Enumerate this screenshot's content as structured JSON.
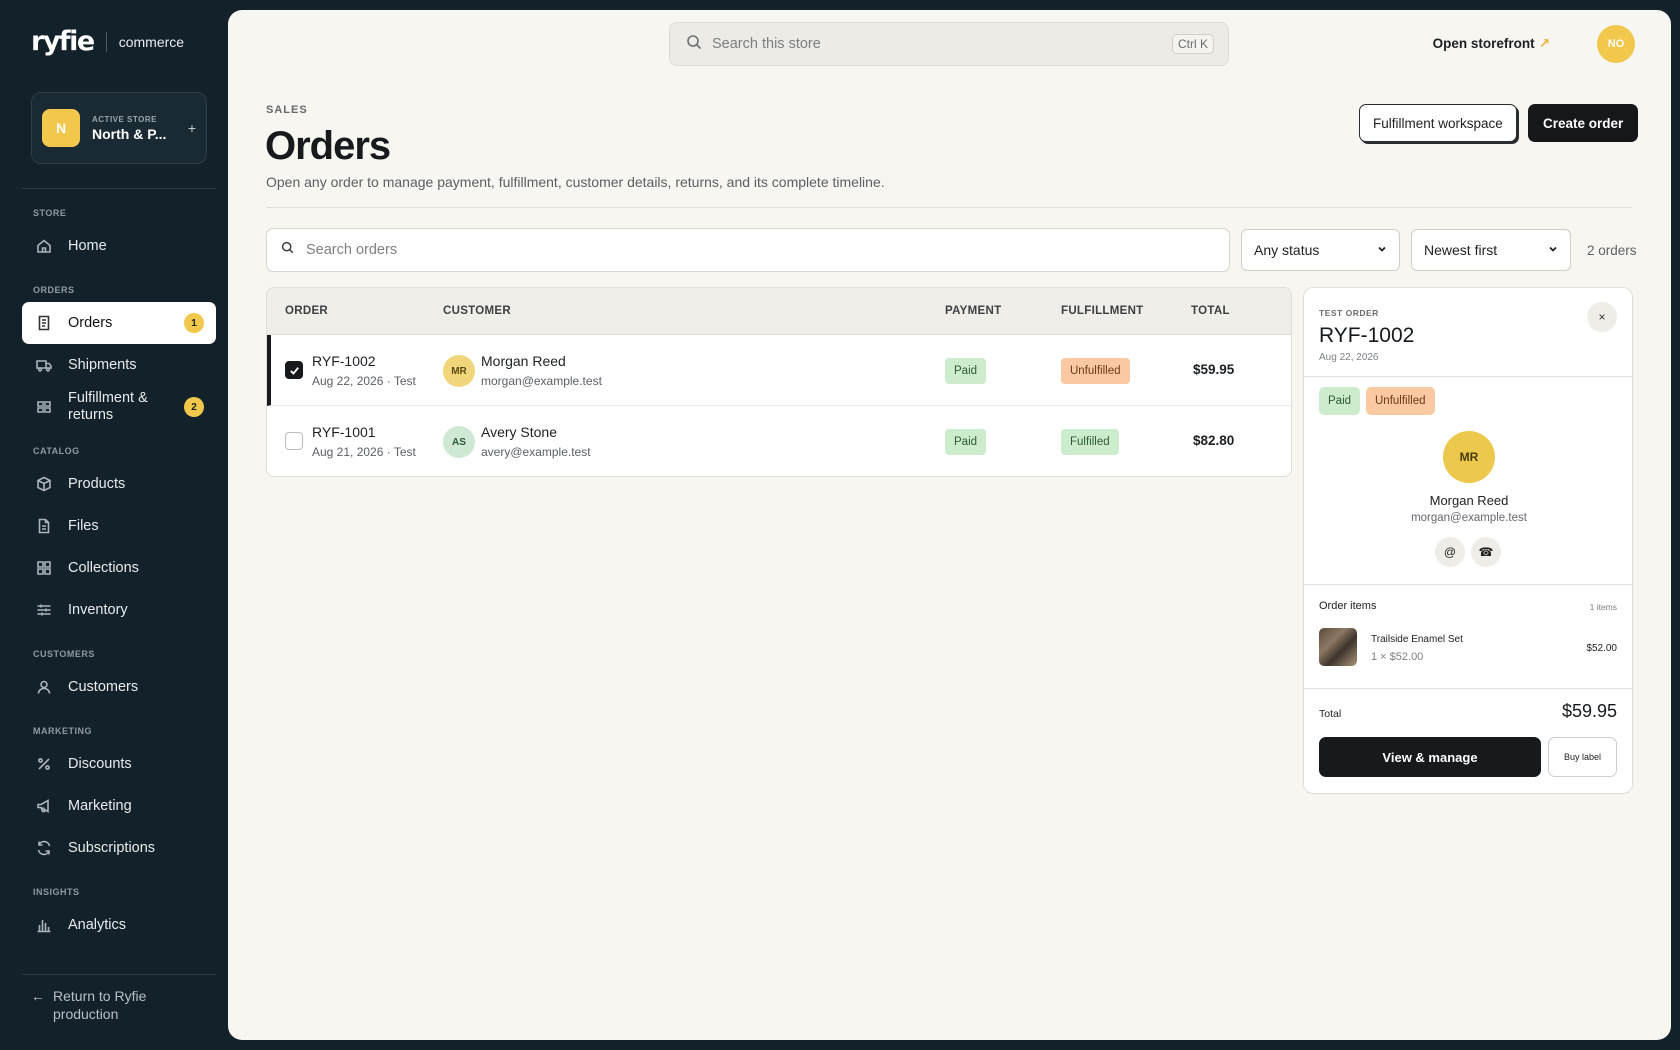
{
  "brand": {
    "logo": "ryfie",
    "sub": "commerce"
  },
  "store": {
    "initial": "N",
    "label": "ACTIVE STORE",
    "name": "North & P...",
    "add": "+"
  },
  "nav": {
    "store_group": "STORE",
    "home": "Home",
    "orders_group": "ORDERS",
    "orders": "Orders",
    "orders_badge": "1",
    "shipments": "Shipments",
    "fulfillment": "Fulfillment & returns",
    "fulfillment_badge": "2",
    "catalog_group": "CATALOG",
    "products": "Products",
    "files": "Files",
    "collections": "Collections",
    "inventory": "Inventory",
    "customers_group": "CUSTOMERS",
    "customers": "Customers",
    "marketing_group": "MARKETING",
    "discounts": "Discounts",
    "marketing": "Marketing",
    "subscriptions": "Subscriptions",
    "insights_group": "INSIGHTS",
    "analytics": "Analytics",
    "return_arrow": "←",
    "return": "Return to Ryfie production"
  },
  "topbar": {
    "search_placeholder": "Search this store",
    "shortcut": "Ctrl K",
    "open_storefront": "Open storefront",
    "open_storefront_arrow": "↗",
    "user_initials": "NO"
  },
  "page": {
    "eyebrow": "SALES",
    "title": "Orders",
    "description": "Open any order to manage payment, fulfillment, customer details, returns, and its complete timeline.",
    "fulfillment_workspace": "Fulfillment workspace",
    "create_order": "Create order"
  },
  "filters": {
    "search_placeholder": "Search orders",
    "status": "Any status",
    "sort": "Newest first",
    "count": "2 orders"
  },
  "table": {
    "headers": {
      "order": "ORDER",
      "customer": "CUSTOMER",
      "payment": "PAYMENT",
      "fulfillment": "FULFILLMENT",
      "total": "TOTAL"
    },
    "rows": [
      {
        "id": "RYF-1002",
        "meta": "Aug 22, 2026 · Test",
        "initials": "MR",
        "name": "Morgan Reed",
        "email": "morgan@example.test",
        "payment": "Paid",
        "fulfillment": "Unfulfilled",
        "total": "$59.95",
        "selected": true
      },
      {
        "id": "RYF-1001",
        "meta": "Aug 21, 2026 · Test",
        "initials": "AS",
        "name": "Avery Stone",
        "email": "avery@example.test",
        "payment": "Paid",
        "fulfillment": "Fulfilled",
        "total": "$82.80",
        "selected": false
      }
    ]
  },
  "detail": {
    "eyebrow": "TEST ORDER",
    "title": "RYF-1002",
    "date": "Aug 22, 2026",
    "close": "×",
    "payment": "Paid",
    "fulfillment": "Unfulfilled",
    "initials": "MR",
    "name": "Morgan Reed",
    "email": "morgan@example.test",
    "email_icon": "@",
    "phone_icon": "☎",
    "items_heading": "Order items",
    "items_count": "1 items",
    "item_name": "Trailside Enamel Set",
    "item_qty": "1 × $52.00",
    "item_price": "$52.00",
    "total_label": "Total",
    "total_value": "$59.95",
    "view_manage": "View & manage",
    "buy_label": "Buy label"
  },
  "colors": {
    "accent": "#f1c84b",
    "sidebar": "#13212a",
    "canvas": "#f7f6f1",
    "paid": "#cdeccd",
    "unfulfilled": "#f9c9a1"
  }
}
